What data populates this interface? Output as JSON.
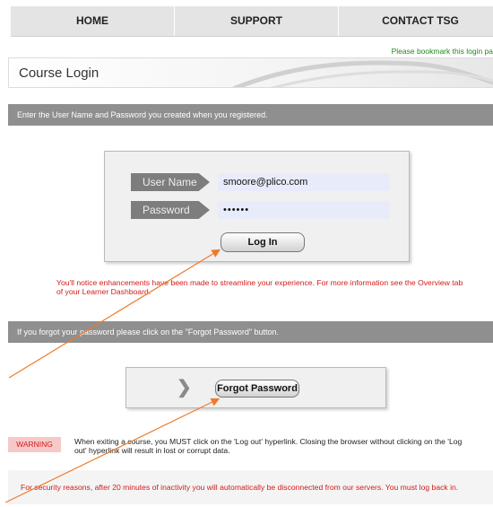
{
  "nav": {
    "items": [
      "HOME",
      "SUPPORT",
      "CONTACT TSG"
    ]
  },
  "bookmark_text": "Please bookmark this login pa",
  "page_title": "Course Login",
  "instructions": "Enter the User Name and Password you created when you registered.",
  "login": {
    "username_label": "User Name",
    "username_value": "smoore@plico.com",
    "password_label": "Password",
    "password_value": "••••••",
    "login_button": "Log In"
  },
  "notice_text": "You'll notice enhancements have been made to streamline your experience. For more information see the Overview tab of your Learner Dashboard.",
  "forgot_instructions": "If you forgot your password please click on the \"Forgot Password\" button.",
  "forgot_button": "Forgot Password",
  "warning": {
    "badge": "WARNING",
    "text": "When exiting a course, you MUST click on the 'Log out' hyperlink. Closing the browser without clicking on the 'Log out' hyperlink will result in lost or corrupt data."
  },
  "security_text": "For security reasons, after 20 minutes of inactivity you will automatically be disconnected from our servers. You must log back in.",
  "colors": {
    "accent_red": "#d41a1a",
    "annotation_arrow": "#f07a2a",
    "bookmark_green": "#1f8a1f",
    "bar_gray": "#8f8f8f"
  },
  "icons": {
    "forgot_chevron": "chevron-right-icon"
  }
}
